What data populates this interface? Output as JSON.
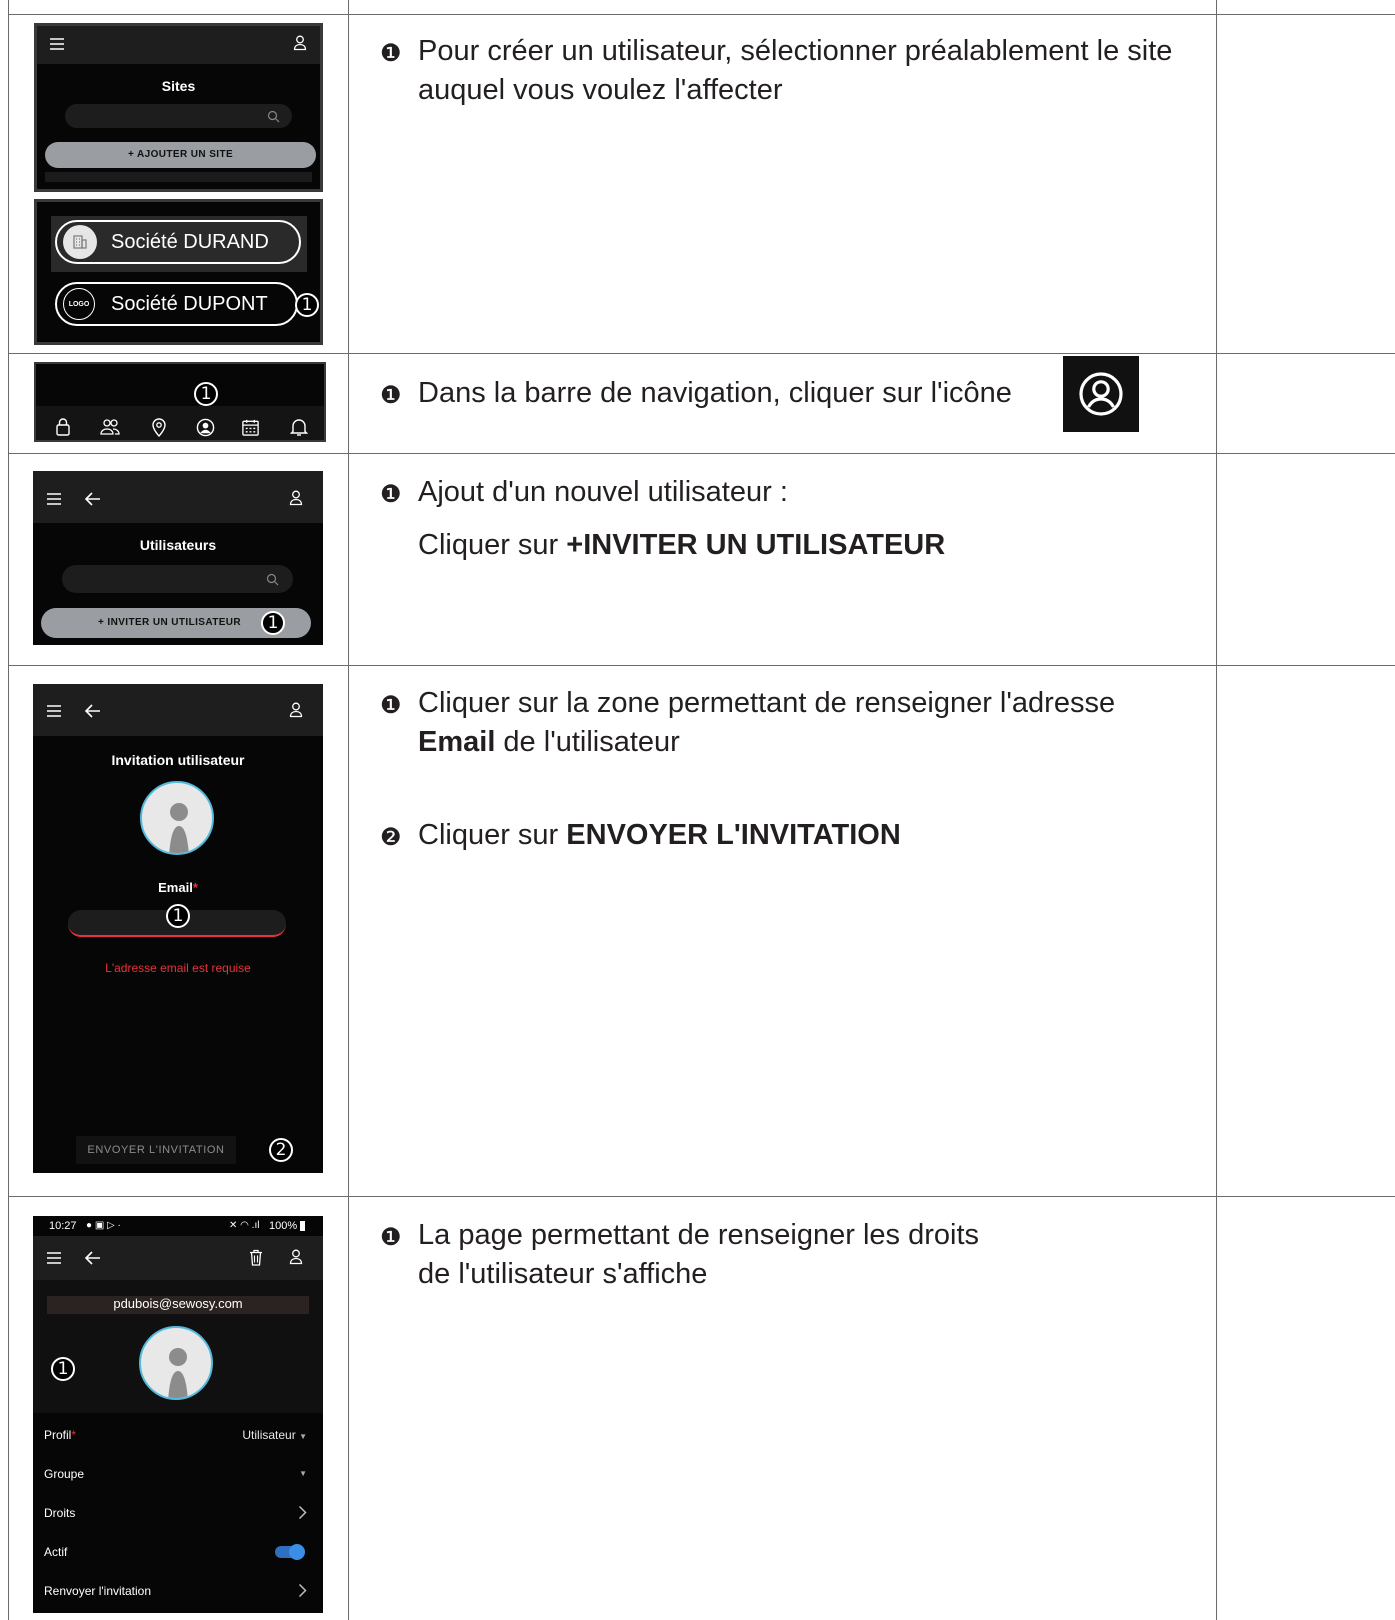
{
  "step1": {
    "text": "Pour créer un utilisateur, sélectionner préalablement le site auquel vous voulez l'affecter",
    "marker": "❶",
    "phone": {
      "title": "Sites",
      "add_button": "+ AJOUTER UN SITE",
      "sites": [
        {
          "name": "Société DURAND"
        },
        {
          "name": "Société DUPONT",
          "logo_text": "LOGO"
        }
      ],
      "callout": "1"
    }
  },
  "step2": {
    "marker": "❶",
    "text": "Dans la barre de navigation, cliquer sur l'icône",
    "callout": "1",
    "nav_icons": [
      "lock-icon",
      "users-icon",
      "location-icon",
      "user-circle-icon",
      "calendar-icon",
      "bell-icon"
    ]
  },
  "step3": {
    "marker": "❶",
    "line1": "Ajout d'un nouvel utilisateur :",
    "line2_prefix": "Cliquer sur ",
    "line2_bold": "+INVITER UN UTILISATEUR",
    "phone": {
      "title": "Utilisateurs",
      "invite_button": "+ INVITER UN UTILISATEUR",
      "callout": "1"
    }
  },
  "step4": {
    "marker1": "❶",
    "line1_prefix": "Cliquer sur la zone permettant de renseigner l'adresse ",
    "line1_bold": "Email",
    "line1_suffix": " de l'utilisateur",
    "marker2": "❷",
    "line2_prefix": "Cliquer sur ",
    "line2_bold": "ENVOYER L'INVITATION",
    "phone": {
      "title": "Invitation utilisateur",
      "email_label": "Email",
      "required_mark": "*",
      "error": "L'adresse email est requise",
      "send_button": "ENVOYER L'INVITATION",
      "callout1": "1",
      "callout2": "2"
    }
  },
  "step5": {
    "marker": "❶",
    "line1": "La page permettant de renseigner les droits",
    "line2": "de l'utilisateur s'affiche",
    "phone": {
      "status_time": "10:27",
      "status_right": "100%",
      "email": "pdubois@sewosy.com",
      "callout": "1",
      "rows": [
        {
          "label": "Profil",
          "required": "*",
          "value": "Utilisateur"
        },
        {
          "label": "Groupe",
          "value": ""
        },
        {
          "label": "Droits"
        },
        {
          "label": "Actif"
        },
        {
          "label": "Renvoyer l'invitation"
        }
      ],
      "active_toggle": true
    }
  },
  "colors": {
    "phone_bg": "#060606",
    "phone_bar": "#1e1e1e",
    "button_gray": "#9a9da2",
    "error_red": "#e8313a",
    "avatar_ring": "#53b9dc",
    "toggle_blue": "#3a8ee6"
  }
}
